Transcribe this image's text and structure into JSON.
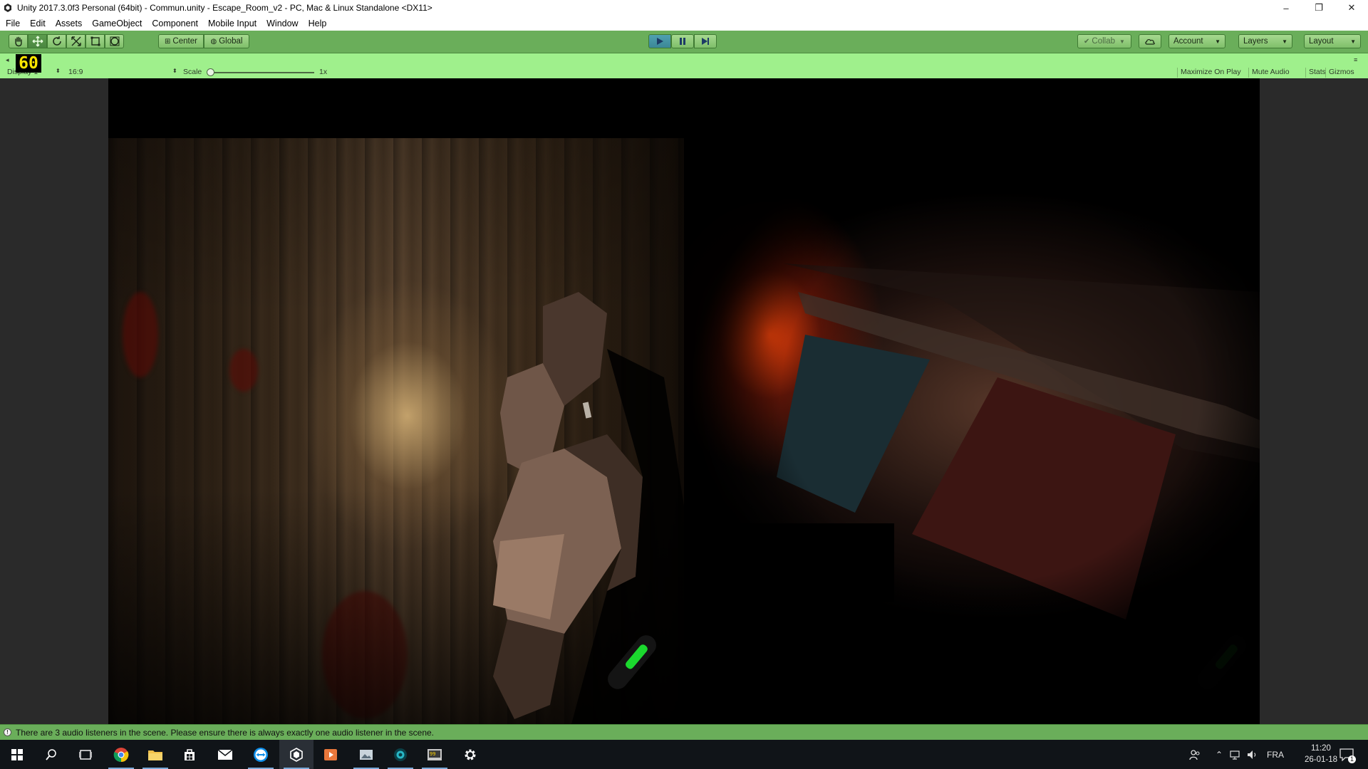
{
  "window": {
    "title": "Unity 2017.3.0f3 Personal (64bit) - Commun.unity - Escape_Room_v2 - PC, Mac & Linux Standalone <DX11>",
    "controls": {
      "minimize": "–",
      "maximize": "❐",
      "close": "✕"
    }
  },
  "menu": {
    "items": [
      "File",
      "Edit",
      "Assets",
      "GameObject",
      "Component",
      "Mobile Input",
      "Window",
      "Help"
    ]
  },
  "toolbar": {
    "tools": [
      "hand-tool",
      "move-tool",
      "rotate-tool",
      "scale-tool",
      "rect-tool",
      "transform-tool"
    ],
    "pivot_label": "Center",
    "space_label": "Global",
    "collab_label": "Collab",
    "account_label": "Account",
    "layers_label": "Layers",
    "layout_label": "Layout",
    "accent_color": "#6aae5a",
    "play_mode_tint": "#9ff08c"
  },
  "game_view": {
    "display_label": "Display 1",
    "aspect_label": "16:9",
    "scale_label": "Scale",
    "scale_value": "1x",
    "fps": "60",
    "toggles": [
      "Maximize On Play",
      "Mute Audio",
      "Stats",
      "Gizmos"
    ]
  },
  "status": {
    "message": "There are 3 audio listeners in the scene. Please ensure there is always exactly one audio listener in the scene."
  },
  "taskbar": {
    "apps": [
      "windows-start",
      "search",
      "task-view",
      "chrome",
      "file-explorer",
      "store",
      "mail",
      "teamviewer",
      "unity",
      "media-player",
      "photos",
      "app-teal",
      "app-99",
      "settings"
    ],
    "language": "FRA",
    "time": "11:20",
    "date": "26-01-18",
    "notification_count": "1"
  }
}
